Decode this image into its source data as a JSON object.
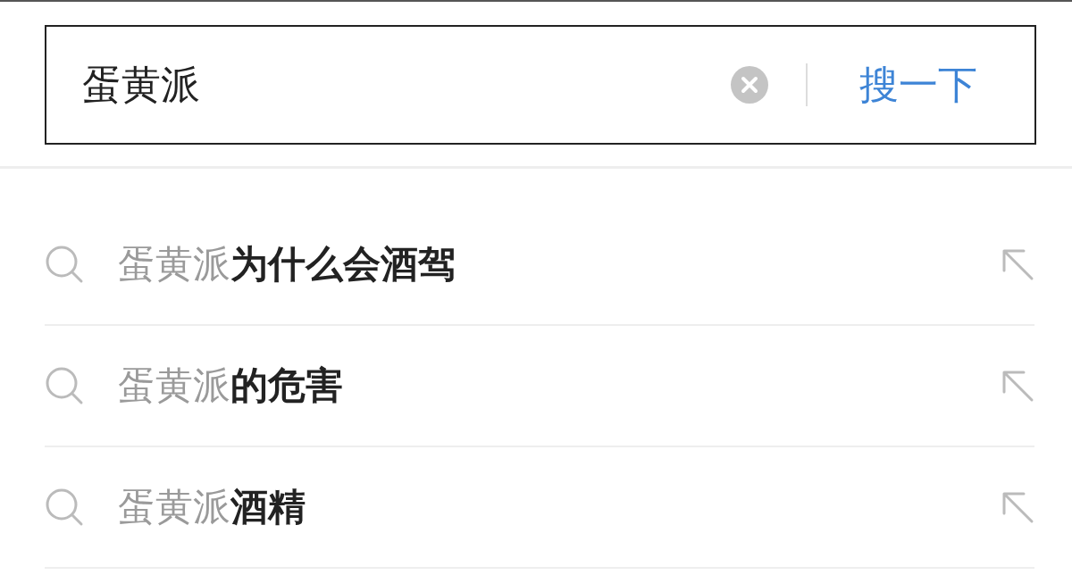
{
  "search": {
    "value": "蛋黄派",
    "button": "搜一下"
  },
  "suggestions": [
    {
      "text": "蛋黄派**为什么会酒驾**"
    },
    {
      "text": "蛋黄派**的危害**"
    },
    {
      "text": "蛋黄派**酒精**"
    }
  ]
}
